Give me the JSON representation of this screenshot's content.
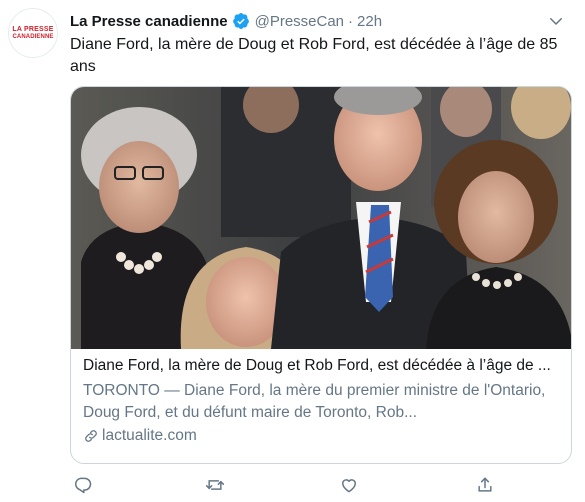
{
  "avatar": {
    "line1": "LA PRESSE",
    "line2": "CANADIENNE"
  },
  "tweet": {
    "display_name": "La Presse canadienne",
    "handle": "@PresseCan",
    "separator": "·",
    "time": "22h",
    "text": "Diane Ford, la mère de Doug et Rob Ford, est décédée à l’âge de 85 ans"
  },
  "card": {
    "title": "Diane Ford, la mère de Doug et Rob Ford, est décédée à l’âge de ...",
    "description": "TORONTO — Diane Ford, la mère du premier ministre de l'Ontario, Doug Ford, et du défunt maire de Toronto, Rob...",
    "domain": "lactualite.com"
  },
  "colors": {
    "accent": "#1da1f2",
    "secondary_text": "#657786",
    "border": "#ccd6dd",
    "brand_red": "#d0202a"
  },
  "icons": {
    "verified": "verified-badge-icon",
    "menu": "chevron-down-icon",
    "link": "link-icon",
    "reply": "reply-icon",
    "retweet": "retweet-icon",
    "like": "heart-icon",
    "share": "share-icon"
  }
}
